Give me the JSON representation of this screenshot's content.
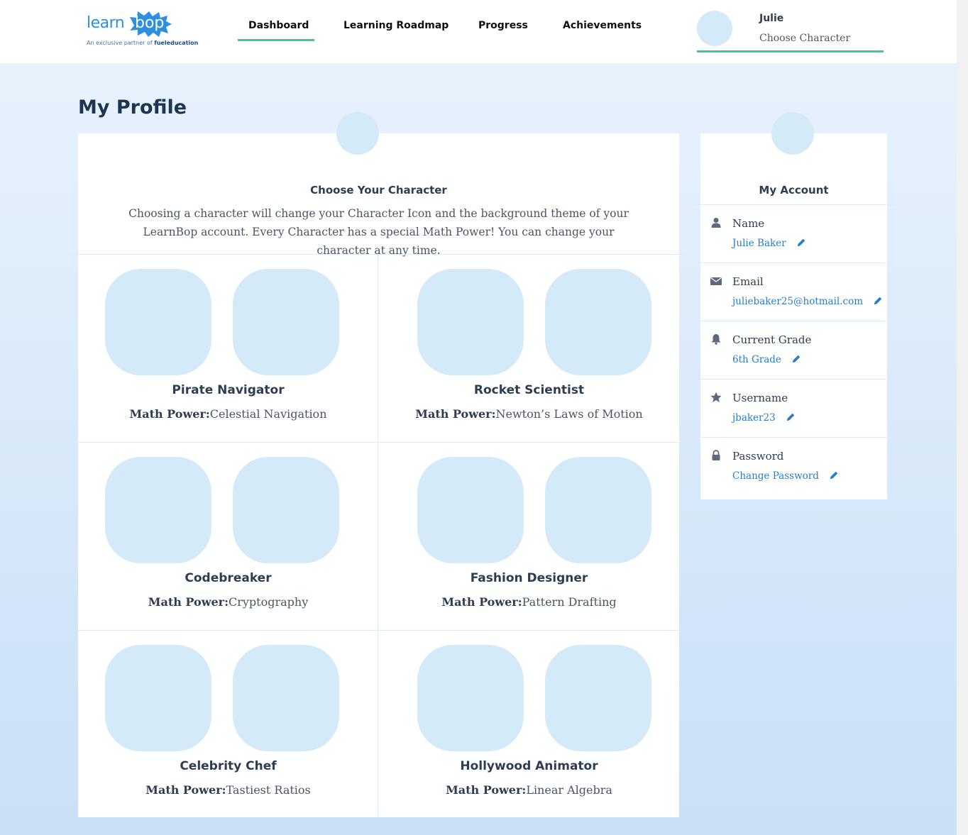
{
  "brand": {
    "logo_left": "learn",
    "logo_right": "bop",
    "partner_text": "An exclusive partner of",
    "partner_name": "fueleducation",
    "accent": "#3cc99a",
    "logo_blue": "#2e8ee0"
  },
  "nav": {
    "items": [
      {
        "label": "Dashboard",
        "active": true
      },
      {
        "label": "Learning Roadmap",
        "active": false
      },
      {
        "label": "Progress",
        "active": false
      },
      {
        "label": "Achievements",
        "active": false
      }
    ]
  },
  "user": {
    "name": "Julie",
    "action": "Choose Character"
  },
  "page": {
    "title": "My Profile"
  },
  "characters_panel": {
    "heading": "Choose Your Character",
    "description": "Choosing a character will change your Character Icon and the background theme of your LearnBop account. Every Character has a special Math Power! You can change your character at any time.",
    "power_label": "Math Power:",
    "characters": [
      {
        "name": "Pirate Navigator",
        "power": "Celestial Navigation"
      },
      {
        "name": "Rocket Scientist",
        "power": "Newton’s Laws of Motion"
      },
      {
        "name": "Codebreaker",
        "power": "Cryptography"
      },
      {
        "name": "Fashion Designer",
        "power": "Pattern Drafting"
      },
      {
        "name": "Celebrity Chef",
        "power": "Tastiest Ratios"
      },
      {
        "name": "Hollywood Animator",
        "power": "Linear Algebra"
      }
    ]
  },
  "account_panel": {
    "heading": "My Account",
    "fields": [
      {
        "label": "Name",
        "value": "Julie Baker",
        "icon": "user-icon"
      },
      {
        "label": "Email",
        "value": "juliebaker25@hotmail.com",
        "icon": "envelope-icon"
      },
      {
        "label": "Current Grade",
        "value": "6th Grade",
        "icon": "bell-icon"
      },
      {
        "label": "Username",
        "value": "jbaker23",
        "icon": "star-icon"
      },
      {
        "label": "Password",
        "value": "Change Password",
        "icon": "lock-icon"
      }
    ]
  }
}
